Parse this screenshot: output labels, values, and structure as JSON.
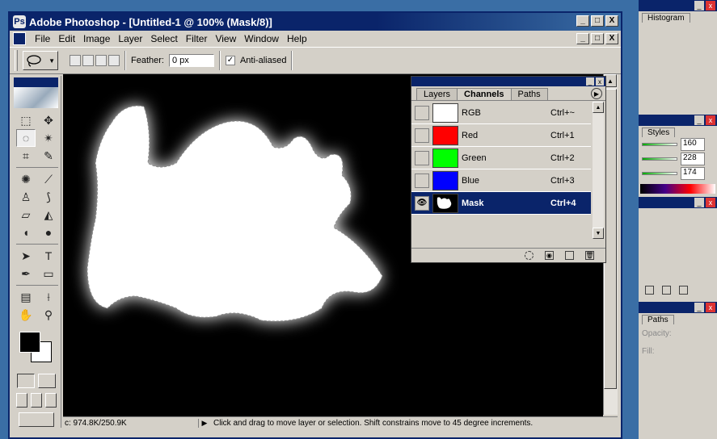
{
  "window": {
    "title": "Adobe Photoshop - [Untitled-1 @ 100% (Mask/8)]",
    "min": "_",
    "max": "□",
    "close": "X"
  },
  "menu": {
    "items": [
      "File",
      "Edit",
      "Image",
      "Layer",
      "Select",
      "Filter",
      "View",
      "Window",
      "Help"
    ]
  },
  "options": {
    "feather_label": "Feather:",
    "feather_value": "0 px",
    "antialiased_label": "Anti-aliased",
    "antialiased_checked": "✓"
  },
  "status": {
    "doc": "c: 974.8K/250.9K",
    "message": "Click and drag to move layer or selection. Shift constrains move to 45 degree increments."
  },
  "channels_palette": {
    "tabs": [
      "Layers",
      "Channels",
      "Paths"
    ],
    "active_tab": "Channels",
    "channels": [
      {
        "name": "RGB",
        "shortcut": "Ctrl+~",
        "color": "#ffffff"
      },
      {
        "name": "Red",
        "shortcut": "Ctrl+1",
        "color": "#ff0000"
      },
      {
        "name": "Green",
        "shortcut": "Ctrl+2",
        "color": "#00ff00"
      },
      {
        "name": "Blue",
        "shortcut": "Ctrl+3",
        "color": "#0000ff"
      },
      {
        "name": "Mask",
        "shortcut": "Ctrl+4",
        "color": "#000000"
      }
    ],
    "selected_channel": "Mask"
  },
  "dock": {
    "histogram_tab": "Histogram",
    "styles_tab": "Styles",
    "values": [
      "160",
      "228",
      "174"
    ],
    "paths_tab": "Paths",
    "opacity_label": "Opacity:",
    "fill_label": "Fill:"
  },
  "colors": {
    "title_blue": "#0a246a",
    "chrome": "#d4d0c8",
    "canvas": "#000000"
  },
  "icons": {
    "lasso": "lasso-icon",
    "eye": "eye-icon"
  }
}
